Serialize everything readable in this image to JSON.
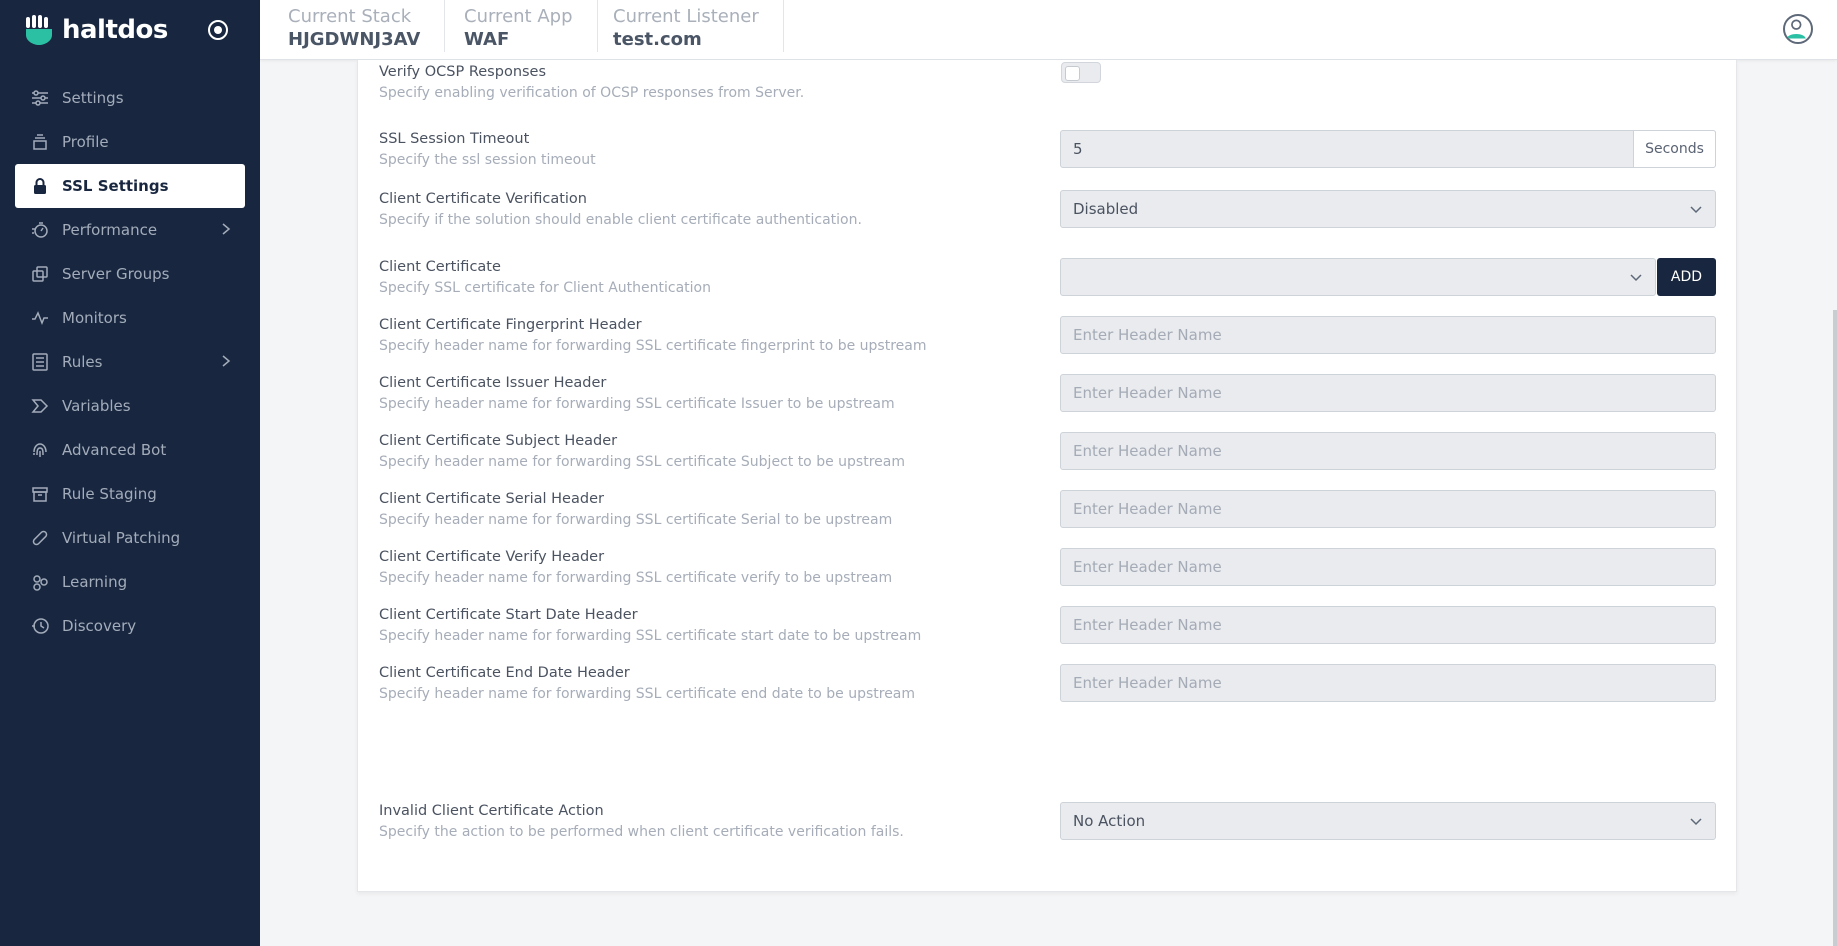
{
  "app": {
    "brand": "haltdos"
  },
  "sidebar": {
    "items": [
      {
        "label": "Settings",
        "icon": "sliders-icon",
        "active": false,
        "has_submenu": false
      },
      {
        "label": "Profile",
        "icon": "stack-icon",
        "active": false,
        "has_submenu": false
      },
      {
        "label": "SSL Settings",
        "icon": "lock-icon",
        "active": true,
        "has_submenu": false
      },
      {
        "label": "Performance",
        "icon": "stopwatch-icon",
        "active": false,
        "has_submenu": true
      },
      {
        "label": "Server Groups",
        "icon": "copy-icon",
        "active": false,
        "has_submenu": false
      },
      {
        "label": "Monitors",
        "icon": "pulse-icon",
        "active": false,
        "has_submenu": false
      },
      {
        "label": "Rules",
        "icon": "list-icon",
        "active": false,
        "has_submenu": true
      },
      {
        "label": "Variables",
        "icon": "tag-icon",
        "active": false,
        "has_submenu": false
      },
      {
        "label": "Advanced Bot",
        "icon": "fingerprint-icon",
        "active": false,
        "has_submenu": false
      },
      {
        "label": "Rule Staging",
        "icon": "archive-icon",
        "active": false,
        "has_submenu": false
      },
      {
        "label": "Virtual Patching",
        "icon": "bandage-icon",
        "active": false,
        "has_submenu": false
      },
      {
        "label": "Learning",
        "icon": "molecule-icon",
        "active": false,
        "has_submenu": false
      },
      {
        "label": "Discovery",
        "icon": "history-icon",
        "active": false,
        "has_submenu": false
      }
    ]
  },
  "header": {
    "crumbs": [
      {
        "label": "Current Stack",
        "value": "HJGDWNJ3AV"
      },
      {
        "label": "Current App",
        "value": "WAF"
      },
      {
        "label": "Current Listener",
        "value": "test.com"
      }
    ]
  },
  "form": {
    "ocsp": {
      "title": "Verify OCSP Responses",
      "desc": "Specify enabling verification of OCSP responses from Server.",
      "enabled": false
    },
    "session_timeout": {
      "title": "SSL Session Timeout",
      "desc": "Specify the ssl session timeout",
      "value": "5",
      "unit": "Seconds"
    },
    "client_verification": {
      "title": "Client Certificate Verification",
      "desc": "Specify if the solution should enable client certificate authentication.",
      "value": "Disabled"
    },
    "client_certificate": {
      "title": "Client Certificate",
      "desc": "Specify SSL certificate for Client Authentication",
      "value": "",
      "add_label": "ADD"
    },
    "headers": [
      {
        "title": "Client Certificate Fingerprint Header",
        "desc": "Specify header name for forwarding SSL certificate fingerprint to be upstream",
        "placeholder": "Enter Header Name"
      },
      {
        "title": "Client Certificate Issuer Header",
        "desc": "Specify header name for forwarding SSL certificate Issuer to be upstream",
        "placeholder": "Enter Header Name"
      },
      {
        "title": "Client Certificate Subject Header",
        "desc": "Specify header name for forwarding SSL certificate Subject to be upstream",
        "placeholder": "Enter Header Name"
      },
      {
        "title": "Client Certificate Serial Header",
        "desc": "Specify header name for forwarding SSL certificate Serial to be upstream",
        "placeholder": "Enter Header Name"
      },
      {
        "title": "Client Certificate Verify Header",
        "desc": "Specify header name for forwarding SSL certificate verify to be upstream",
        "placeholder": "Enter Header Name"
      },
      {
        "title": "Client Certificate Start Date Header",
        "desc": "Specify header name for forwarding SSL certificate start date to be upstream",
        "placeholder": "Enter Header Name"
      },
      {
        "title": "Client Certificate End Date Header",
        "desc": "Specify header name for forwarding SSL certificate end date to be upstream",
        "placeholder": "Enter Header Name"
      }
    ],
    "invalid_action": {
      "title": "Invalid Client Certificate Action",
      "desc": "Specify the action to be performed when client certificate verification fails.",
      "value": "No Action"
    }
  }
}
